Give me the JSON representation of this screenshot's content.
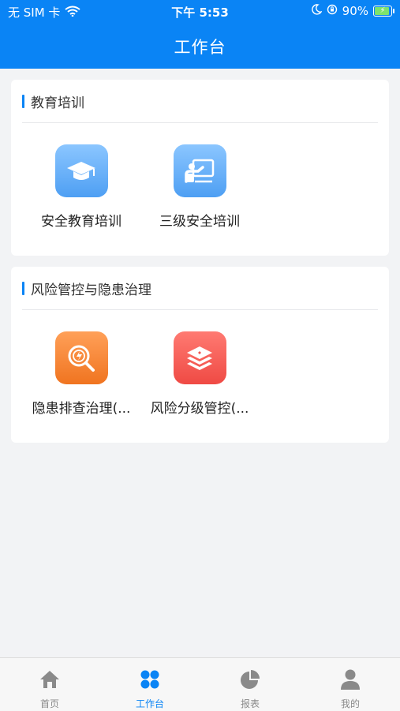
{
  "status_bar": {
    "carrier": "无 SIM 卡",
    "time": "下午 5:53",
    "battery": "90%",
    "battery_level": 0.9
  },
  "header": {
    "title": "工作台"
  },
  "sections": [
    {
      "title": "教育培训",
      "items": [
        {
          "label": "安全教育培训",
          "icon": "graduation-cap-icon",
          "color": "#5aa9f7"
        },
        {
          "label": "三级安全培训",
          "icon": "teacher-board-icon",
          "color": "#5aa9f7"
        }
      ]
    },
    {
      "title": "风险管控与隐患治理",
      "items": [
        {
          "label": "隐患排查治理(...",
          "icon": "hazard-search-icon",
          "color": "#f58030"
        },
        {
          "label": "风险分级管控(...",
          "icon": "risk-layers-icon",
          "color": "#f25650"
        }
      ]
    }
  ],
  "tabbar": {
    "active": "工作台",
    "tabs": [
      {
        "label": "首页",
        "icon": "home-icon"
      },
      {
        "label": "工作台",
        "icon": "workbench-icon"
      },
      {
        "label": "报表",
        "icon": "pie-chart-icon"
      },
      {
        "label": "我的",
        "icon": "user-icon"
      }
    ]
  },
  "colors": {
    "primary": "#0a84f5",
    "background": "#f2f3f5"
  }
}
